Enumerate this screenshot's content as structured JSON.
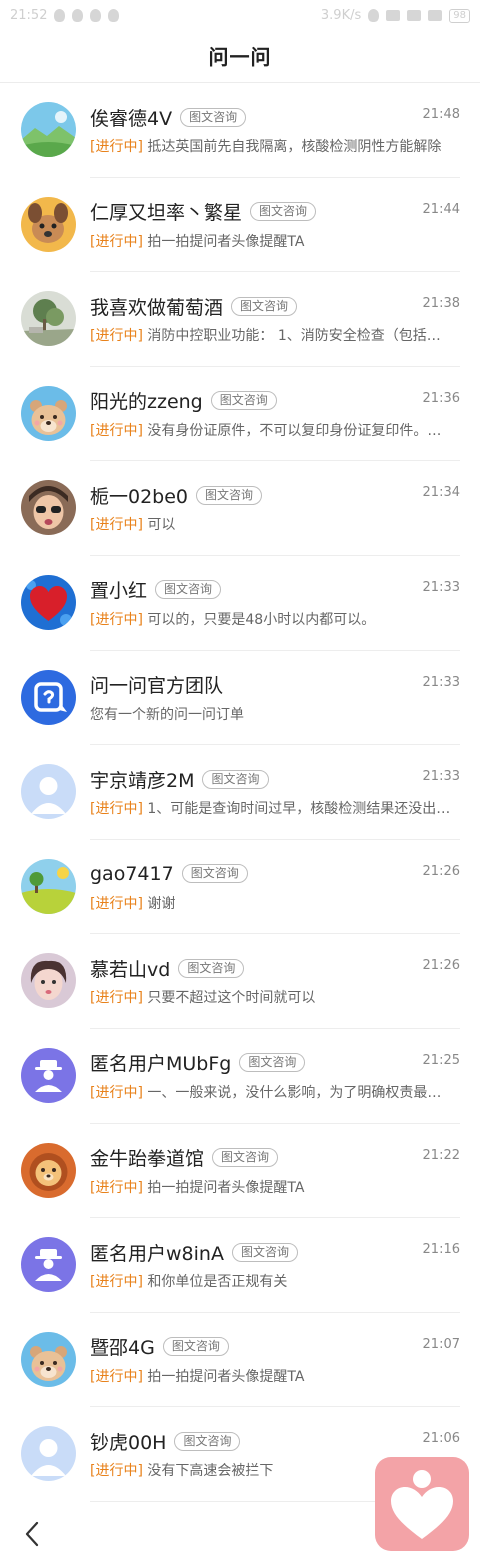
{
  "status_bar": {
    "time": "21:52",
    "speed": "3.9K/s",
    "battery": "98"
  },
  "header": {
    "title": "问一问"
  },
  "tag_label": "图文咨询",
  "items": [
    {
      "name": "俟睿德4V",
      "tag": "图文咨询",
      "time": "21:48",
      "status": "[进行中]",
      "message": "抵达英国前先自我隔离，核酸检测阴性方能解除",
      "avatar": "landscape-avatar"
    },
    {
      "name": "仁厚又坦率丶繁星",
      "tag": "图文咨询",
      "time": "21:44",
      "status": "[进行中]",
      "message": "拍一拍提问者头像提醒TA",
      "avatar": "dog-avatar"
    },
    {
      "name": "我喜欢做葡萄酒",
      "tag": "图文咨询",
      "time": "21:38",
      "status": "[进行中]",
      "message": "消防中控职业功能： 1、消防安全检查（包括…",
      "avatar": "garden-avatar"
    },
    {
      "name": "阳光的zzeng",
      "tag": "图文咨询",
      "time": "21:36",
      "status": "[进行中]",
      "message": "没有身份证原件，不可以复印身份证复印件。…",
      "avatar": "bear-avatar"
    },
    {
      "name": "栀一02be0",
      "tag": "图文咨询",
      "time": "21:34",
      "status": "[进行中]",
      "message": "可以",
      "avatar": "child-avatar"
    },
    {
      "name": "置小红",
      "tag": "图文咨询",
      "time": "21:33",
      "status": "[进行中]",
      "message": "可以的，只要是48小时以内都可以。",
      "avatar": "heart-avatar"
    },
    {
      "name": "问一问官方团队",
      "tag": "",
      "time": "21:33",
      "status": "",
      "message": "您有一个新的问一问订单",
      "avatar": "official-avatar"
    },
    {
      "name": "宇京靖彦2M",
      "tag": "图文咨询",
      "time": "21:33",
      "status": "[进行中]",
      "message": "1、可能是查询时间过早，核酸检测结果还没出…",
      "avatar": "default-user-avatar"
    },
    {
      "name": "gao7417",
      "tag": "图文咨询",
      "time": "21:26",
      "status": "[进行中]",
      "message": "谢谢",
      "avatar": "field-avatar"
    },
    {
      "name": "慕若山vd",
      "tag": "图文咨询",
      "time": "21:26",
      "status": "[进行中]",
      "message": "只要不超过这个时间就可以",
      "avatar": "girl-avatar"
    },
    {
      "name": "匿名用户MUbFg",
      "tag": "图文咨询",
      "time": "21:25",
      "status": "[进行中]",
      "message": "一、一般来说，没什么影响，为了明确权责最…",
      "avatar": "anonymous-avatar"
    },
    {
      "name": "金牛跆拳道馆",
      "tag": "图文咨询",
      "time": "21:22",
      "status": "[进行中]",
      "message": "拍一拍提问者头像提醒TA",
      "avatar": "lion-avatar"
    },
    {
      "name": "匿名用户w8inA",
      "tag": "图文咨询",
      "time": "21:16",
      "status": "[进行中]",
      "message": "和你单位是否正规有关",
      "avatar": "anonymous-avatar"
    },
    {
      "name": "暨邵4G",
      "tag": "图文咨询",
      "time": "21:07",
      "status": "[进行中]",
      "message": "拍一拍提问者头像提醒TA",
      "avatar": "bear-avatar"
    },
    {
      "name": "钞虎00H",
      "tag": "图文咨询",
      "time": "21:06",
      "status": "[进行中]",
      "message": "没有下高速会被拦下",
      "avatar": "default-user-avatar"
    }
  ],
  "colors": {
    "status": "#e8811a",
    "float_button": "#f3a3a7",
    "divider": "#ededed"
  }
}
